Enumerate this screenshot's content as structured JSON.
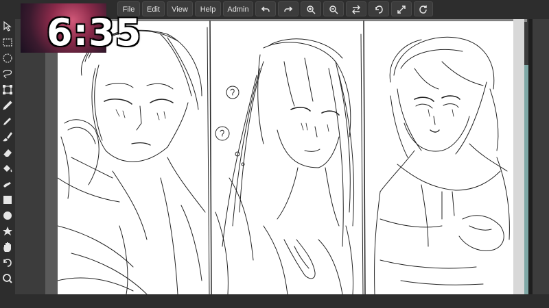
{
  "menu": {
    "file": "File",
    "edit": "Edit",
    "view": "View",
    "help": "Help",
    "admin": "Admin"
  },
  "toolbar_icons": [
    "undo-icon",
    "redo-icon",
    "zoom-in-icon",
    "zoom-out-icon",
    "flip-icon",
    "rotate-icon",
    "fullscreen-icon",
    "reset-icon"
  ],
  "tools": [
    "select-arrow-icon",
    "rect-select-icon",
    "ellipse-select-icon",
    "lasso-icon",
    "transform-icon",
    "eyedropper-icon",
    "pencil-icon",
    "brush-icon",
    "eraser-icon",
    "fill-bucket-icon",
    "smudge-icon",
    "rectangle-icon",
    "ellipse-icon",
    "star-icon",
    "hand-icon",
    "rotate-view-icon",
    "zoom-icon"
  ],
  "stream": {
    "timer": "6:35"
  },
  "colors": {
    "background": "#2d2d2d",
    "button": "#3c3c3c",
    "paper": "#ffffff",
    "accent_strip": "#7fa8a6"
  }
}
